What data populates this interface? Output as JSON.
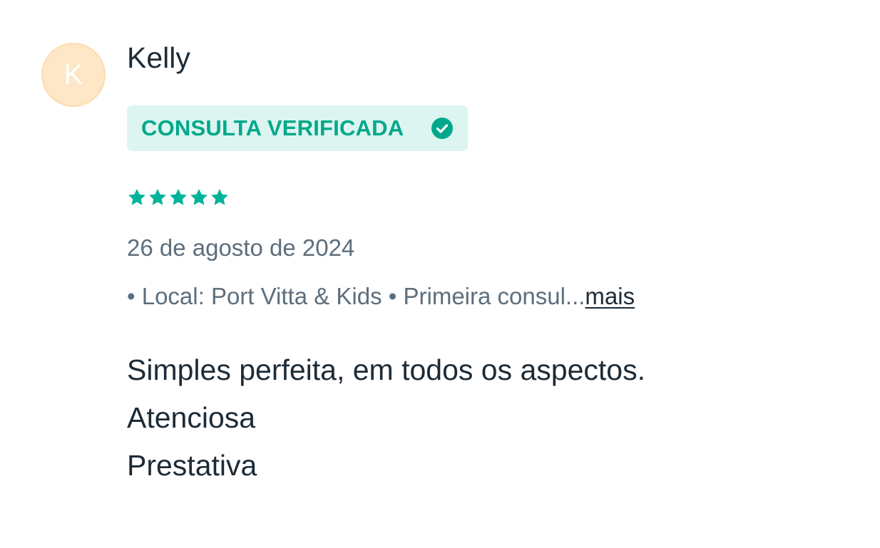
{
  "review": {
    "avatar": {
      "letter": "K",
      "bg_color": "#fde7c6"
    },
    "author": "Kelly",
    "badge": {
      "label": "CONSULTA VERIFICADA",
      "icon": "check-circle-icon",
      "color": "#00a88a"
    },
    "rating": {
      "value": 5,
      "max": 5,
      "star_color": "#00b39a"
    },
    "date": "26 de agosto de 2024",
    "details": {
      "text": "• Local: Port Vitta & Kids • Primeira consul...",
      "more_label": "mais"
    },
    "body_lines": [
      "Simples perfeita, em todos os aspectos.",
      "Atenciosa",
      "Prestativa"
    ]
  }
}
